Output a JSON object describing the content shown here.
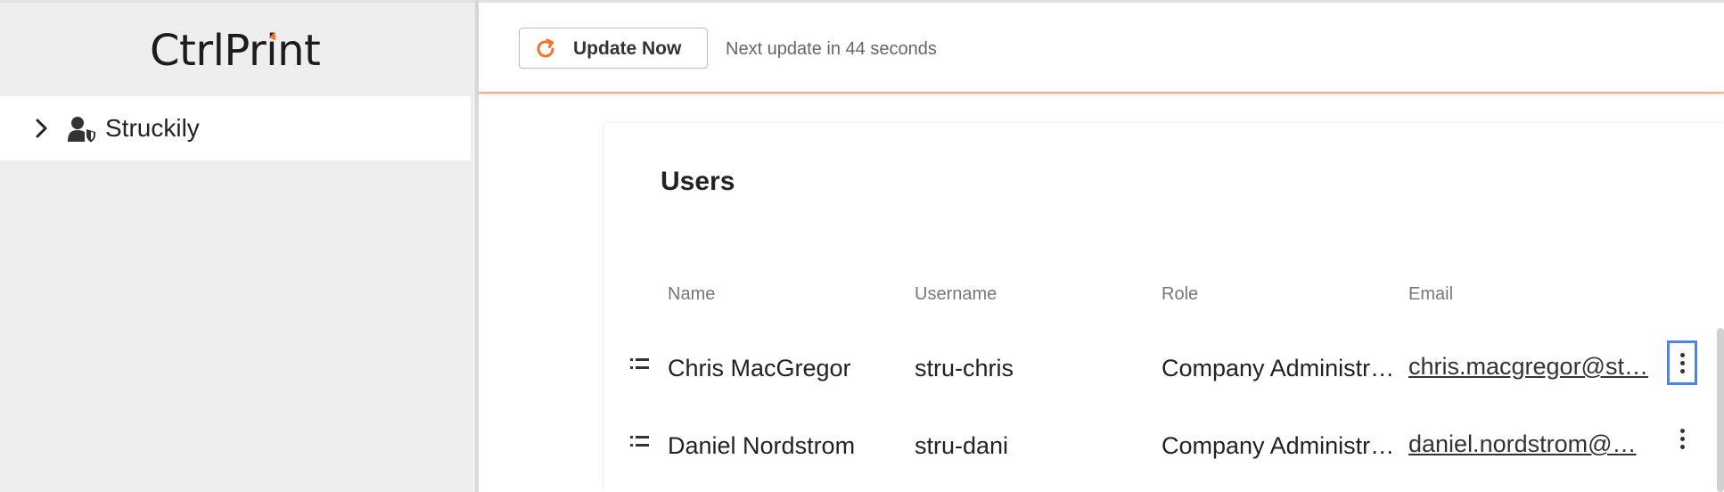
{
  "app": {
    "logo_text": "CtrlPrint",
    "accent_color": "#f2732c",
    "focus_color": "#4a86e8"
  },
  "sidebar": {
    "items": [
      {
        "label": "Struckily",
        "icon": "user-shield-icon",
        "expand_icon": "chevron-right-icon"
      }
    ]
  },
  "header": {
    "update_button_label": "Update Now",
    "update_icon": "refresh-icon",
    "next_update_text": "Next update in 44 seconds"
  },
  "users_card": {
    "title": "Users",
    "columns": [
      "Name",
      "Username",
      "Role",
      "Email"
    ],
    "rows": [
      {
        "name": "Chris MacGregor",
        "username": "stru-chris",
        "role": "Company Administr…",
        "email": "chris.macgregor@st…"
      },
      {
        "name": "Daniel Nordstrom",
        "username": "stru-dani",
        "role": "Company Administr…",
        "email": "daniel.nordstrom@…"
      }
    ]
  }
}
